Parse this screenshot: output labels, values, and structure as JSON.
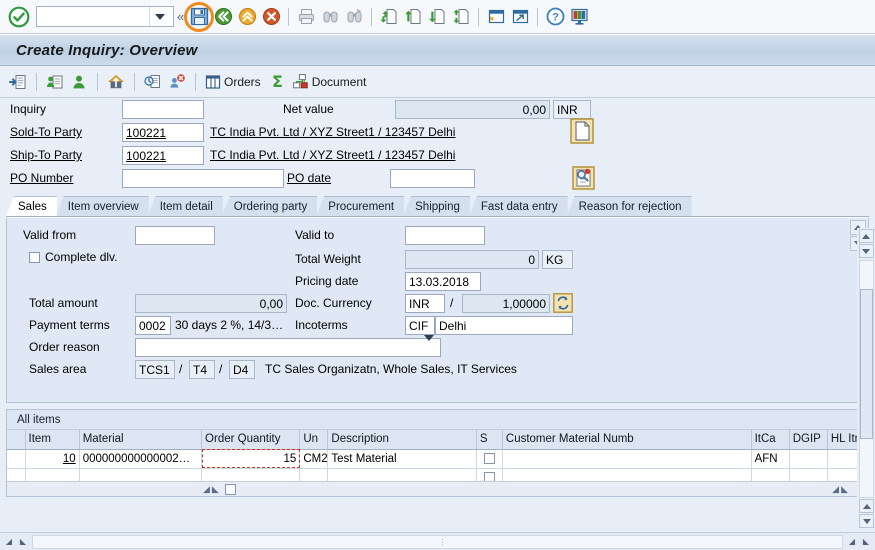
{
  "window": {
    "title": "Create Inquiry: Overview"
  },
  "colors": {
    "accent_orange": "#f08a1e",
    "titlebar_blue": "#bed0e4",
    "page_bg": "#e8eef7",
    "focus_cell_yellow": "#fbe9a9",
    "focus_cell_border": "#d03020"
  },
  "main_toolbar": {
    "ok_icon": "green-check-icon",
    "command_field": {
      "value": "",
      "placeholder": ""
    },
    "dropdown_icon": "chevron-down-icon",
    "collapse_icon": "double-chevron-left-icon",
    "buttons": [
      {
        "name": "save-button",
        "icon": "save-floppy-icon",
        "label": "Save",
        "highlighted": true
      },
      {
        "name": "back-button",
        "icon": "back-green-arrow-icon",
        "label": "Back",
        "highlighted": false
      },
      {
        "name": "exit-button",
        "icon": "exit-yellow-arrow-icon",
        "label": "Exit",
        "highlighted": false
      },
      {
        "name": "cancel-button",
        "icon": "cancel-red-x-icon",
        "label": "Cancel",
        "highlighted": false
      },
      {
        "name": "print-button",
        "icon": "printer-icon",
        "label": "Print",
        "highlighted": false
      },
      {
        "name": "find-button",
        "icon": "binoculars-icon",
        "label": "Find",
        "highlighted": false
      },
      {
        "name": "find-next-button",
        "icon": "binoculars-plus-icon",
        "label": "Find Next",
        "highlighted": false
      },
      {
        "name": "first-page-button",
        "icon": "first-page-icon",
        "label": "First Page",
        "highlighted": false
      },
      {
        "name": "previous-page-button",
        "icon": "previous-page-icon",
        "label": "Previous Page",
        "highlighted": false
      },
      {
        "name": "next-page-button",
        "icon": "next-page-icon",
        "label": "Next Page",
        "highlighted": false
      },
      {
        "name": "last-page-button",
        "icon": "last-page-icon",
        "label": "Last Page",
        "highlighted": false
      },
      {
        "name": "create-session-button",
        "icon": "new-session-icon",
        "label": "Create New Session",
        "highlighted": false
      },
      {
        "name": "create-shortcut-button",
        "icon": "shortcut-icon",
        "label": "Create Shortcut",
        "highlighted": false
      },
      {
        "name": "help-button",
        "icon": "help-question-icon",
        "label": "Help",
        "highlighted": false
      },
      {
        "name": "customize-button",
        "icon": "monitor-customize-icon",
        "label": "Customize Local Layout",
        "highlighted": false
      }
    ]
  },
  "app_toolbar": {
    "buttons": [
      {
        "name": "overview-button",
        "icon": "document-arrow-icon",
        "label": ""
      },
      {
        "name": "sold-to-party-button",
        "icon": "person-card-icon",
        "label": ""
      },
      {
        "name": "partner-button",
        "icon": "person-green-icon",
        "label": ""
      },
      {
        "name": "shipping-point-button",
        "icon": "house-arrow-icon",
        "label": ""
      },
      {
        "name": "copy-button",
        "icon": "copy-clock-icon",
        "label": ""
      },
      {
        "name": "delete-item-button",
        "icon": "person-delete-icon",
        "label": ""
      },
      {
        "name": "orders-button",
        "icon": "list-columns-icon",
        "label": "Orders"
      },
      {
        "name": "sum-button",
        "icon": "sigma-icon",
        "label": ""
      },
      {
        "name": "document-button",
        "icon": "document-flow-icon",
        "label": "Document"
      }
    ]
  },
  "header_form": {
    "inquiry": {
      "label": "Inquiry",
      "value": ""
    },
    "net_value": {
      "label": "Net value",
      "value": "0,00",
      "currency": "INR"
    },
    "sold_to_party": {
      "label": "Sold-To Party",
      "value": "100221",
      "description": "TC India Pvt. Ltd / XYZ Street1 / 123457 Delhi"
    },
    "ship_to_party": {
      "label": "Ship-To Party",
      "value": "100221",
      "description": "TC India Pvt. Ltd / XYZ Street1 / 123457 Delhi"
    },
    "po_number": {
      "label": "PO Number",
      "value": ""
    },
    "po_date": {
      "label": "PO date",
      "value": ""
    },
    "icons": [
      {
        "name": "document-page-icon",
        "title": "Display Document"
      },
      {
        "name": "document-search-icon",
        "title": "Document Search"
      }
    ]
  },
  "tabs": [
    {
      "label": "Sales",
      "active": true
    },
    {
      "label": "Item overview",
      "active": false
    },
    {
      "label": "Item detail",
      "active": false
    },
    {
      "label": "Ordering party",
      "active": false
    },
    {
      "label": "Procurement",
      "active": false
    },
    {
      "label": "Shipping",
      "active": false
    },
    {
      "label": "Fast data entry",
      "active": false
    },
    {
      "label": "Reason for rejection",
      "active": false
    }
  ],
  "sales_tab": {
    "valid_from": {
      "label": "Valid from",
      "value": ""
    },
    "valid_to": {
      "label": "Valid to",
      "value": ""
    },
    "complete_dlv": {
      "label": "Complete dlv.",
      "checked": false
    },
    "total_weight": {
      "label": "Total Weight",
      "value": "0",
      "unit": "KG"
    },
    "pricing_date": {
      "label": "Pricing date",
      "value": "13.03.2018"
    },
    "total_amount": {
      "label": "Total amount",
      "value": "0,00"
    },
    "doc_currency": {
      "label": "Doc. Currency",
      "value": "INR",
      "separator": "/",
      "rate": "1,00000"
    },
    "exchange_rate_icon": "refresh-exchange-icon",
    "payment_terms": {
      "label": "Payment terms",
      "code": "0002",
      "text": "30 days 2 %, 14/3…"
    },
    "incoterms": {
      "label": "Incoterms",
      "code": "CIF",
      "text": "Delhi"
    },
    "order_reason": {
      "label": "Order reason",
      "value": "",
      "dropdown_icon": "chevron-down-icon"
    },
    "sales_area": {
      "label": "Sales area",
      "org": "TCS1",
      "sep1": "/",
      "channel": "T4",
      "sep2": "/",
      "division": "D4",
      "description": "TC Sales Organizatn, Whole Sales, IT Services"
    }
  },
  "items": {
    "section_title": "All items",
    "columns": [
      "Item",
      "Material",
      "Order Quantity",
      "Un",
      "Description",
      "S",
      "Customer Material Numb",
      "ItCa",
      "DGIP",
      "HL Itm"
    ],
    "rows": [
      {
        "item": "10",
        "material": "000000000000002…",
        "order_quantity": "15",
        "un": "CM2",
        "description": "Test Material",
        "s": "",
        "customer_material_numb": "",
        "itca": "AFN",
        "dgip": "",
        "hl_itm": "",
        "focused_cell": "order_quantity"
      },
      {
        "item": "",
        "material": "",
        "order_quantity": "",
        "un": "",
        "description": "",
        "s": "",
        "customer_material_numb": "",
        "itca": "",
        "dgip": "",
        "hl_itm": "",
        "focused_cell": ""
      }
    ]
  },
  "scrollbars": {
    "panel_up_icon": "scroll-up-icon",
    "panel_down_icon": "scroll-down-icon",
    "vertical_up_icon": "scroll-up-icon",
    "vertical_down_icon": "scroll-down-icon",
    "horizontal_left_icon": "scroll-left-icon",
    "horizontal_right_icon": "scroll-right-icon"
  }
}
